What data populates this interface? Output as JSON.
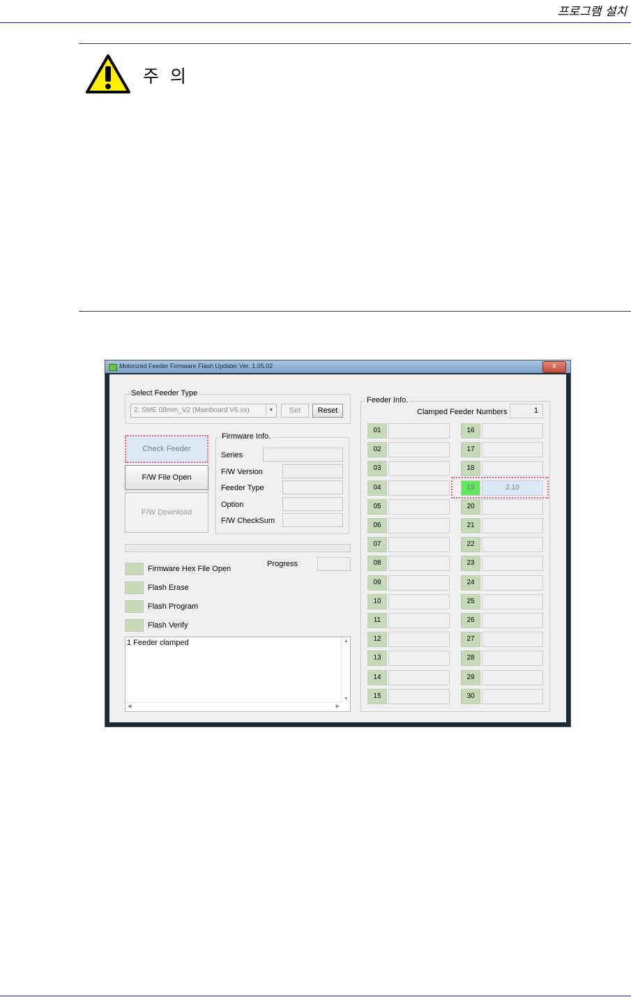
{
  "header": {
    "title": "프로그램 설치"
  },
  "caution": {
    "label": "주 의",
    "icon": "warning-triangle-icon"
  },
  "window": {
    "title": "Motorized Feeder Firmware Flash Updater Ver. 1.05.02",
    "close_label": "x"
  },
  "select_feeder": {
    "group_label": "Select Feeder Type",
    "selected": "2. SME 08mm_V2 (Mainboard V6.xx)",
    "set_label": "Set",
    "reset_label": "Reset"
  },
  "buttons": {
    "check_feeder": "Check Feeder",
    "fw_file_open": "F/W File Open",
    "fw_download": "F/W Download"
  },
  "firmware_info": {
    "group_label": "Firmware Info.",
    "fields": [
      "Series",
      "F/W Version",
      "Feeder Type",
      "Option",
      "F/W CheckSum"
    ]
  },
  "progress": {
    "label": "Progress",
    "value": 0
  },
  "steps": [
    "Firmware Hex File Open",
    "Flash Erase",
    "Flash Program",
    "Flash Verify"
  ],
  "log": {
    "text": "1 Feeder clamped"
  },
  "feeder_info": {
    "group_label": "Feeder Info.",
    "clamped_label": "Clamped Feeder Numbers",
    "clamped_value": "1",
    "slots": [
      {
        "num": "01",
        "val": ""
      },
      {
        "num": "02",
        "val": ""
      },
      {
        "num": "03",
        "val": ""
      },
      {
        "num": "04",
        "val": ""
      },
      {
        "num": "05",
        "val": ""
      },
      {
        "num": "06",
        "val": ""
      },
      {
        "num": "07",
        "val": ""
      },
      {
        "num": "08",
        "val": ""
      },
      {
        "num": "09",
        "val": ""
      },
      {
        "num": "10",
        "val": ""
      },
      {
        "num": "11",
        "val": ""
      },
      {
        "num": "12",
        "val": ""
      },
      {
        "num": "13",
        "val": ""
      },
      {
        "num": "14",
        "val": ""
      },
      {
        "num": "15",
        "val": ""
      },
      {
        "num": "16",
        "val": ""
      },
      {
        "num": "17",
        "val": ""
      },
      {
        "num": "18",
        "val": ""
      },
      {
        "num": "19",
        "val": "2.10",
        "active": true
      },
      {
        "num": "20",
        "val": ""
      },
      {
        "num": "21",
        "val": ""
      },
      {
        "num": "22",
        "val": ""
      },
      {
        "num": "23",
        "val": ""
      },
      {
        "num": "24",
        "val": ""
      },
      {
        "num": "25",
        "val": ""
      },
      {
        "num": "26",
        "val": ""
      },
      {
        "num": "27",
        "val": ""
      },
      {
        "num": "28",
        "val": ""
      },
      {
        "num": "29",
        "val": ""
      },
      {
        "num": "30",
        "val": ""
      }
    ]
  }
}
